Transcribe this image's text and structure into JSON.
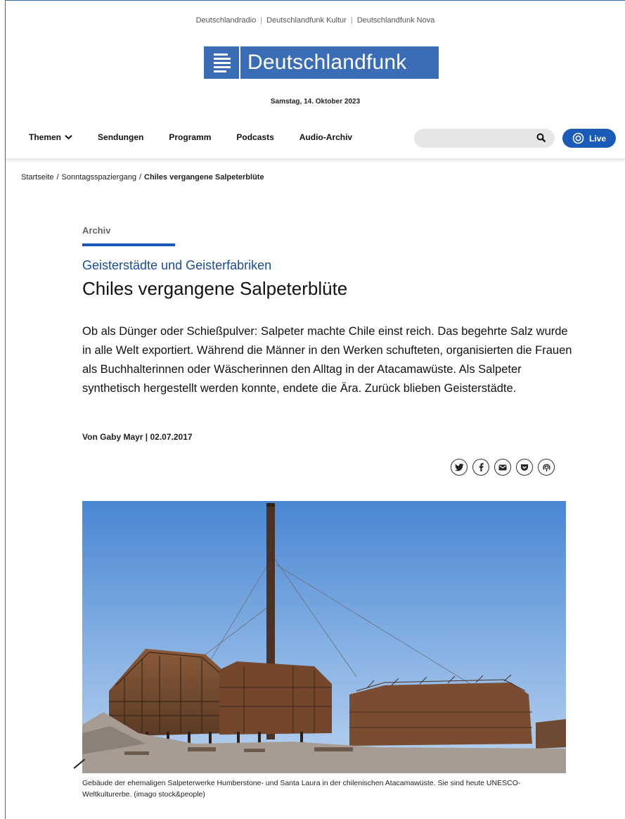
{
  "header": {
    "family_links": [
      "Deutschlandradio",
      "Deutschlandfunk Kultur",
      "Deutschlandfunk Nova"
    ],
    "logo_text": "Deutschlandfunk",
    "date": "Samstag, 14. Oktober 2023",
    "nav": [
      {
        "label": "Themen",
        "icon": "chevron-down-icon"
      },
      {
        "label": "Sendungen"
      },
      {
        "label": "Programm"
      },
      {
        "label": "Podcasts"
      },
      {
        "label": "Audio-Archiv"
      }
    ],
    "search": {
      "placeholder": "",
      "icon": "search-icon"
    },
    "live_label": "Live",
    "brand_color": "#3a6db5",
    "accent_color": "#1a5ab8"
  },
  "breadcrumb": {
    "items": [
      "Startseite",
      "Sonntagsspaziergang",
      "Chiles vergangene Salpeterblüte"
    ]
  },
  "article": {
    "category": "Archiv",
    "subtitle": "Geisterstädte und Geisterfabriken",
    "title": "Chiles vergangene Salpeterblüte",
    "teaser": "Ob als Dünger oder Schießpulver: Salpeter machte Chile einst reich. Das begehrte Salz wurde in alle Welt exportiert. Während die Männer in den Werken schufteten, organisierten die Frauen als Buchhalterinnen oder Wäscherinnen den Alltag in der Atacamawüste. Als Salpeter synthetisch hergestellt werden konnte, endete die Ära. Zurück blieben Geisterstädte.",
    "byline": "Von Gaby Mayr | 02.07.2017",
    "share_icons": [
      "twitter-icon",
      "facebook-icon",
      "mail-icon",
      "pocket-icon",
      "podcast-icon"
    ],
    "caption": "Gebäude der ehemaligen Salpeterwerke Humberstone- und Santa Laura in der chilenischen Atacamawüste. Sie sind heute UNESCO-Weltkulturerbe. (imago stock&people)"
  }
}
